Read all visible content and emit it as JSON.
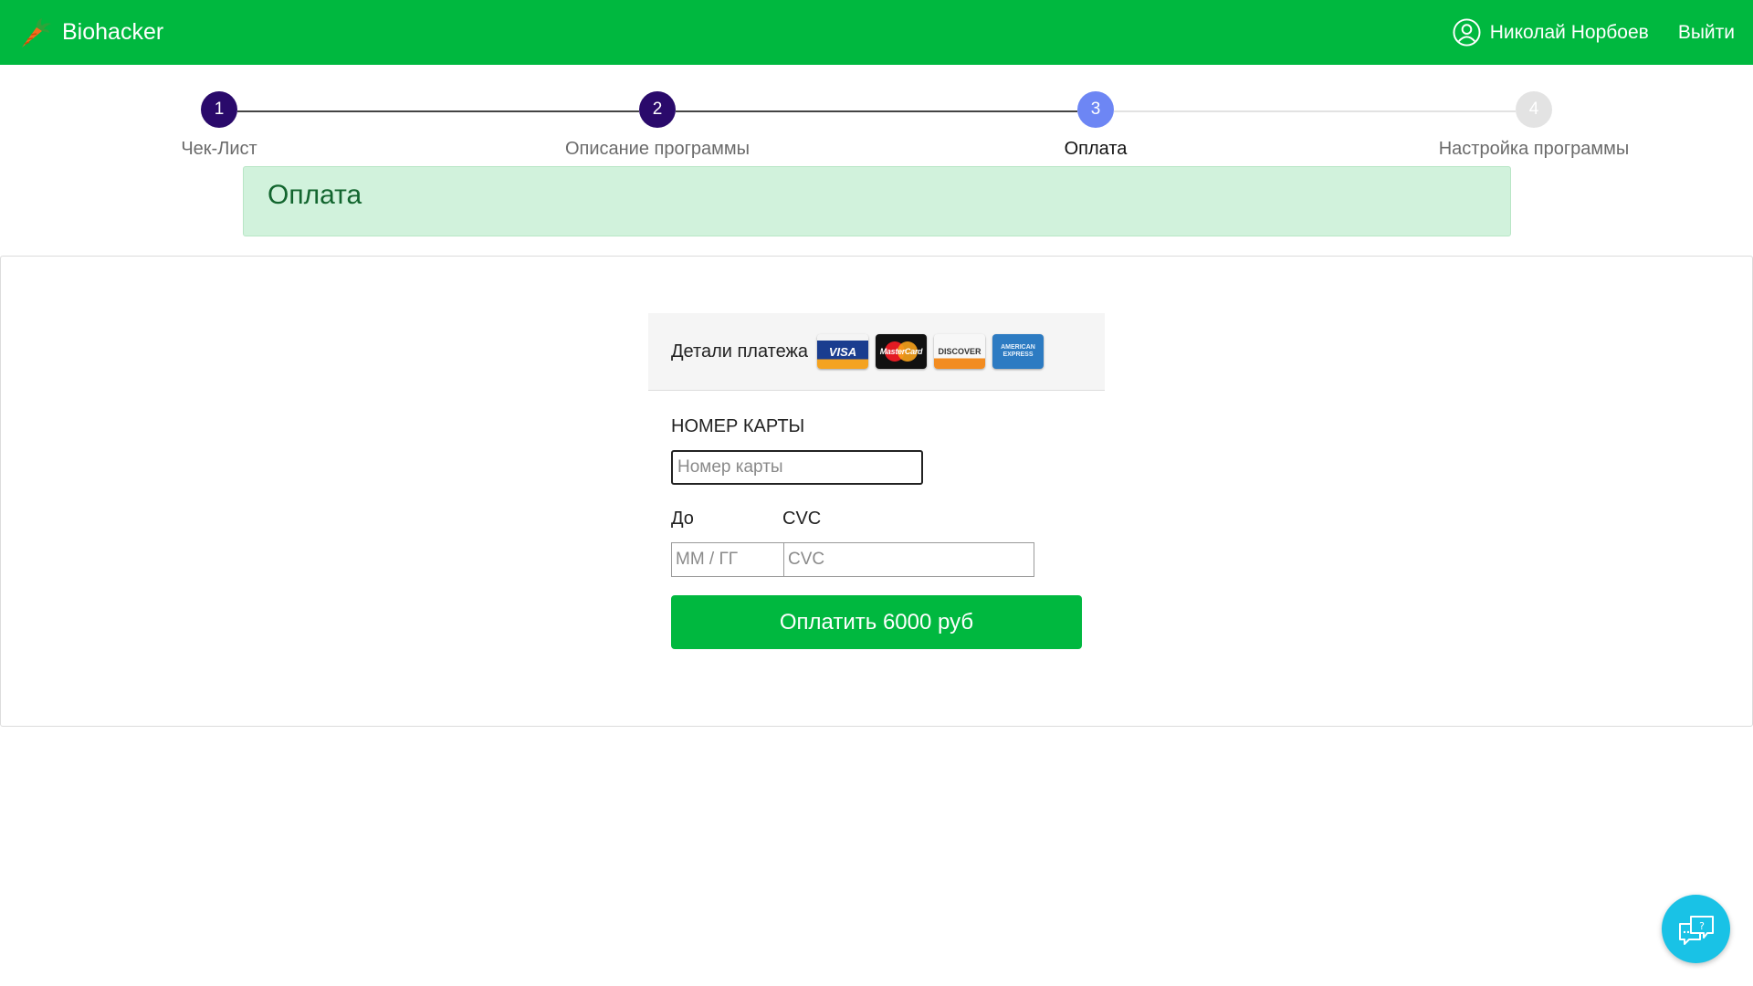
{
  "header": {
    "brand": "Biohacker",
    "user_name": "Николай Норбоев",
    "logout_label": "Выйти",
    "bg_color": "#00b83f"
  },
  "stepper": {
    "steps": [
      {
        "number": "1",
        "label": "Чек-Лист",
        "state": "done"
      },
      {
        "number": "2",
        "label": "Описание программы",
        "state": "done"
      },
      {
        "number": "3",
        "label": "Оплата",
        "state": "active"
      },
      {
        "number": "4",
        "label": "Настройка программы",
        "state": "pending"
      }
    ],
    "colors": {
      "done": "#2a0a6b",
      "active": "#6d86f4",
      "pending": "#e3e3e3"
    }
  },
  "alert": {
    "title": "Оплата"
  },
  "payment": {
    "panel_title": "Детали платежа",
    "card_logos": [
      {
        "icon": "visa-card-icon",
        "text": "VISA"
      },
      {
        "icon": "mastercard-card-icon",
        "text": "MasterCard"
      },
      {
        "icon": "discover-card-icon",
        "text": "DISCOVER"
      },
      {
        "icon": "amex-card-icon",
        "text": "AMERICAN EXPRESS"
      }
    ],
    "card_number_label": "НОМЕР КАРТЫ",
    "card_number_placeholder": "Номер карты",
    "card_number_value": "",
    "expiry_label": "До",
    "expiry_placeholder": "ММ / ГГ",
    "cvc_label": "CVC",
    "cvc_placeholder": "CVC",
    "pay_button": "Оплатить 6000 руб"
  },
  "help": {
    "icon": "help-chat-icon"
  }
}
